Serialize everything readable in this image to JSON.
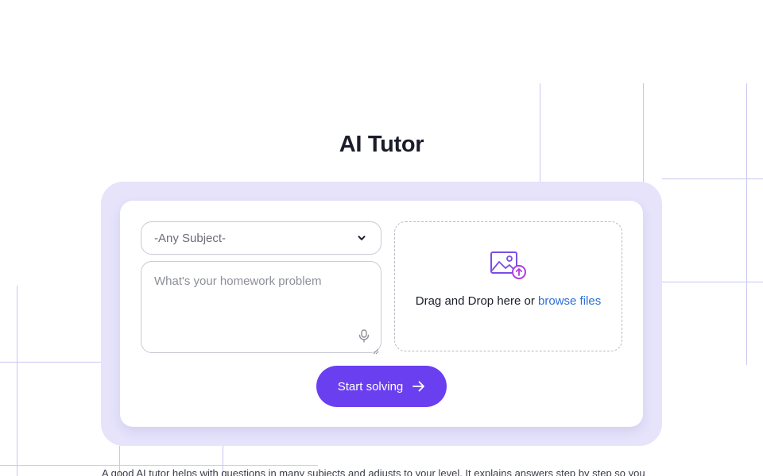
{
  "page": {
    "title": "AI Tutor"
  },
  "form": {
    "subject_select": {
      "selected": "-Any Subject-"
    },
    "problem_input": {
      "placeholder": "What's your homework problem",
      "value": ""
    },
    "upload": {
      "prompt": "Drag and Drop here or",
      "browse_link": "browse files"
    },
    "submit_label": "Start solving"
  },
  "intro": {
    "text": "A good AI tutor helps with questions in many subjects and adjusts to your level. It explains answers step by step so you"
  },
  "icons": {
    "subject_select": "chevron-down-icon",
    "problem_input": "microphone-icon",
    "upload": "image-upload-icon",
    "submit": "arrow-right-icon"
  },
  "colors": {
    "accent": "#6a3ff0",
    "card_outer": "#e6e3fb",
    "link": "#2e6ed6",
    "grid_line": "#c9c6f2"
  }
}
